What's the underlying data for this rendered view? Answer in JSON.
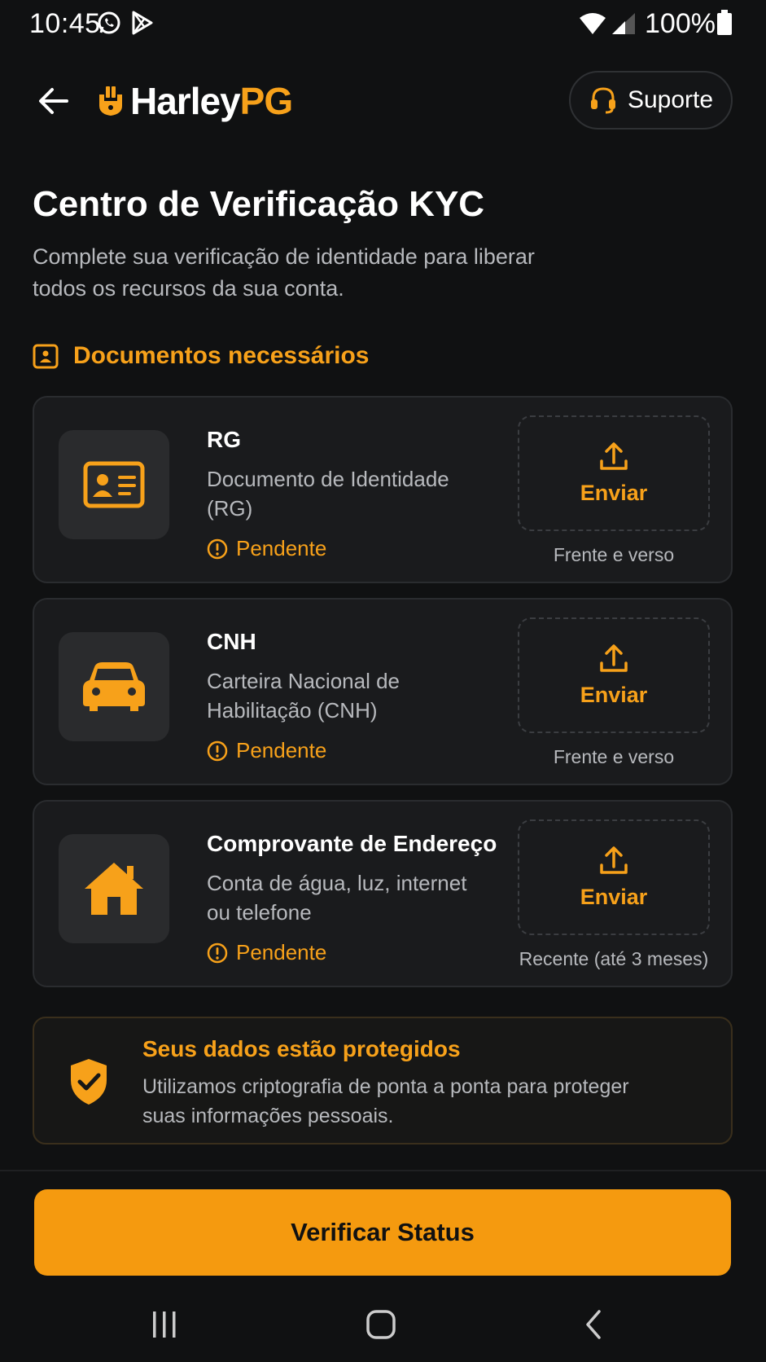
{
  "status_bar": {
    "time": "10:45",
    "battery": "100%",
    "icons": [
      "whatsapp-icon",
      "play-store-icon",
      "wifi-icon",
      "signal-icon",
      "battery-icon"
    ]
  },
  "header": {
    "logo_white": "Harley",
    "logo_orange": "PG",
    "support_label": "Suporte"
  },
  "page": {
    "title": "Centro de Verificação KYC",
    "subtitle": "Complete sua verificação de identidade para liberar todos os recursos da sua conta."
  },
  "section": {
    "title": "Documentos necessários"
  },
  "documents": [
    {
      "name": "RG",
      "description": "Documento de Identidade (RG)",
      "status": "Pendente",
      "action": "Enviar",
      "hint": "Frente e verso",
      "icon": "id-card-icon"
    },
    {
      "name": "CNH",
      "description": "Carteira Nacional de Habilitação (CNH)",
      "status": "Pendente",
      "action": "Enviar",
      "hint": "Frente e verso",
      "icon": "car-icon"
    },
    {
      "name": "Comprovante de Endereço",
      "description": "Conta de água, luz, internet ou telefone",
      "status": "Pendente",
      "action": "Enviar",
      "hint": "Recente (até 3 meses)",
      "icon": "house-icon"
    }
  ],
  "notice": {
    "title": "Seus dados estão protegidos",
    "text": "Utilizamos criptografia de ponta a ponta para proteger suas informações pessoais."
  },
  "cta": {
    "label": "Verificar Status"
  },
  "colors": {
    "accent": "#f7a11a",
    "background": "#101112",
    "card": "#1a1b1d",
    "muted_text": "#b7b9bd"
  }
}
